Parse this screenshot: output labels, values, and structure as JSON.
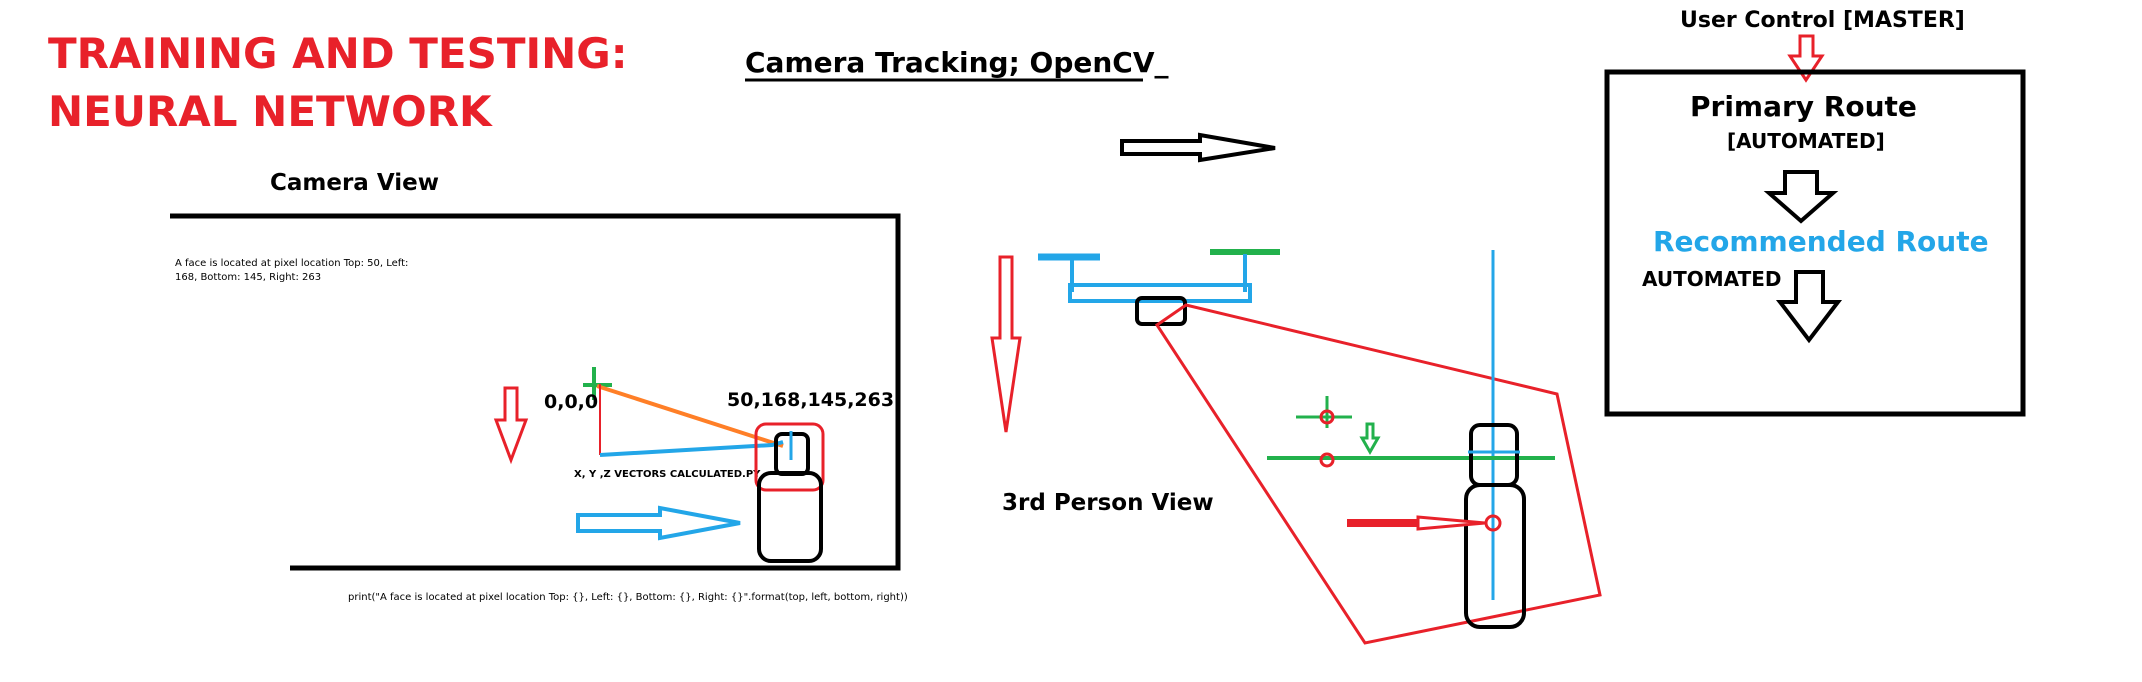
{
  "title": {
    "line1": "TRAINING AND TESTING:",
    "line2": "NEURAL NETWORK"
  },
  "subtitle": "Camera Tracking; OpenCV_",
  "camera_view": {
    "label": "Camera View",
    "face_text_line1": "A face is located at pixel location Top: 50, Left:",
    "face_text_line2": "168, Bottom: 145, Right: 263",
    "origin_label": "0,0,0",
    "coords_label": "50,168,145,263",
    "vectors_label": "X, Y ,Z VECTORS CALCULATED.PY",
    "print_code": "print(\"A face is located at pixel location Top: {}, Left: {}, Bottom: {}, Right: {}\".format(top, left, bottom, right))"
  },
  "third_person": {
    "label": "3rd Person View"
  },
  "control": {
    "user_label": "User Control [MASTER]",
    "primary_label": "Primary Route",
    "automated1": "[AUTOMATED]",
    "recommended_label": "Recommended Route",
    "automated2": "AUTOMATED"
  },
  "colors": {
    "red": "#e8212a",
    "blue": "#23a6e8",
    "green": "#22b14c",
    "orange": "#ff7f27",
    "black": "#000000"
  }
}
